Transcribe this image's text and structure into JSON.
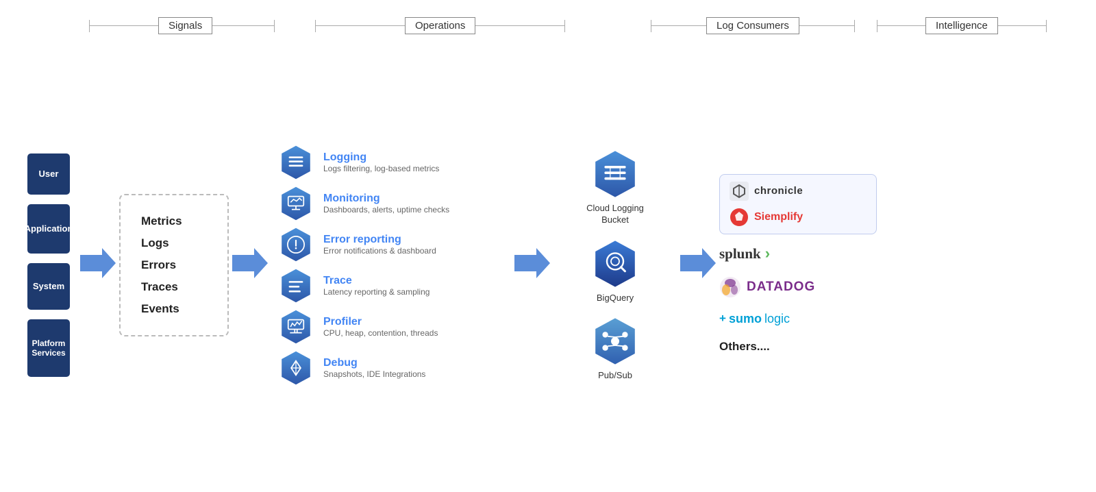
{
  "sections": {
    "signals": "Signals",
    "operations": "Operations",
    "log_consumers": "Log Consumers",
    "intelligence": "Intelligence"
  },
  "sources": [
    {
      "label": "User",
      "size": "tall"
    },
    {
      "label": "Application",
      "size": "medium"
    },
    {
      "label": "System",
      "size": "medium2"
    },
    {
      "label": "Platform Services",
      "size": "taller"
    }
  ],
  "signals": [
    "Metrics",
    "Logs",
    "Errors",
    "Traces",
    "Events"
  ],
  "operations": [
    {
      "title": "Logging",
      "desc": "Logs filtering, log-based metrics",
      "icon": "logging"
    },
    {
      "title": "Monitoring",
      "desc": "Dashboards, alerts, uptime checks",
      "icon": "monitoring"
    },
    {
      "title": "Error reporting",
      "desc": "Error notifications & dashboard",
      "icon": "error-reporting"
    },
    {
      "title": "Trace",
      "desc": "Latency reporting & sampling",
      "icon": "trace"
    },
    {
      "title": "Profiler",
      "desc": "CPU, heap, contention, threads",
      "icon": "profiler"
    },
    {
      "title": "Debug",
      "desc": "Snapshots, IDE Integrations",
      "icon": "debug"
    }
  ],
  "consumers": [
    {
      "label": "Cloud Logging\nBucket",
      "icon": "logging-bucket"
    },
    {
      "label": "BigQuery",
      "icon": "bigquery"
    },
    {
      "label": "Pub/Sub",
      "icon": "pubsub"
    }
  ],
  "intelligence": [
    {
      "type": "box",
      "name": "chronicle",
      "label": "chronicle"
    },
    {
      "type": "box",
      "name": "siemplify",
      "label": "Siemplify"
    },
    {
      "type": "standalone",
      "name": "splunk",
      "label": "splunk"
    },
    {
      "type": "standalone",
      "name": "datadog",
      "label": "DATADOG"
    },
    {
      "type": "standalone",
      "name": "sumologic",
      "label": "sumologic"
    },
    {
      "type": "standalone",
      "name": "others",
      "label": "Others...."
    }
  ],
  "colors": {
    "primary_blue": "#2d57a8",
    "dark_navy": "#1e3a6e",
    "light_blue": "#4285f4",
    "arrow_blue": "#4a7fd4",
    "hex_gradient_top": "#4a90d9",
    "hex_gradient_bottom": "#2d57a8"
  }
}
